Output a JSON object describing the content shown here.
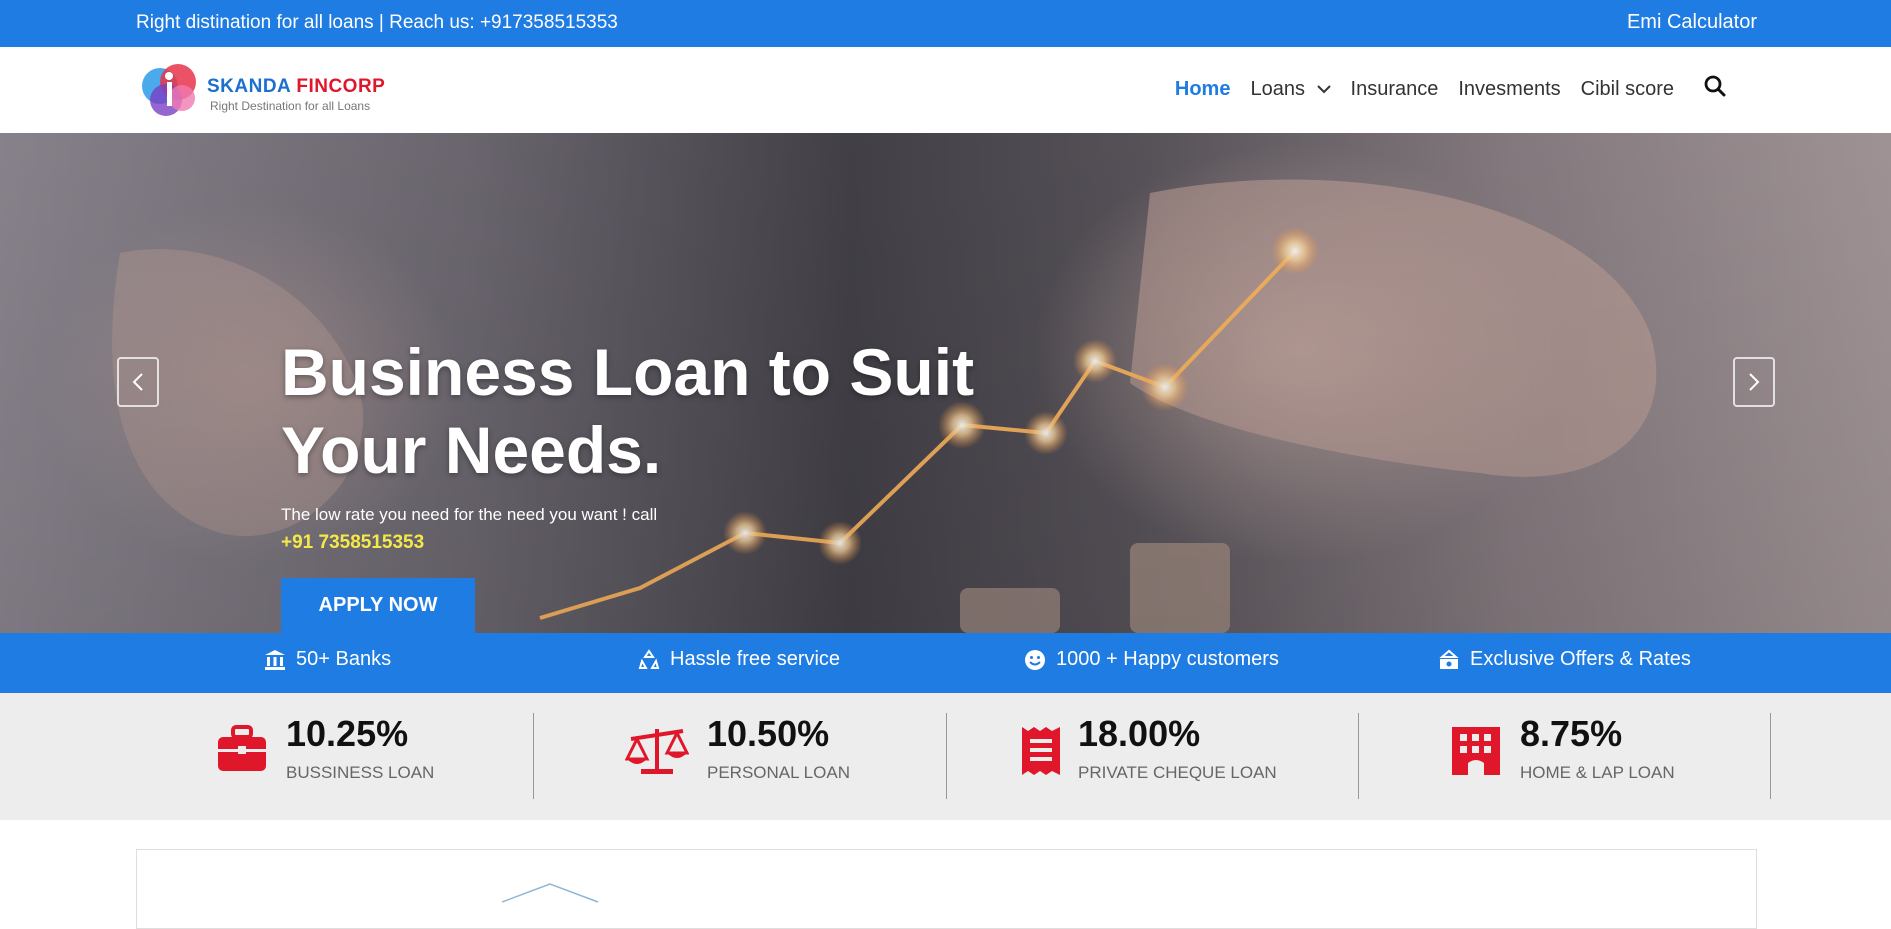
{
  "topbar": {
    "tagline": "Right distination for all loans | Reach us: +917358515353",
    "emi_link": "Emi Calculator"
  },
  "logo": {
    "brand_part1": "SKANDA",
    "brand_part2": "FINCORP",
    "subtitle": "Right Destination for all Loans"
  },
  "nav": {
    "items": [
      {
        "label": "Home",
        "active": true
      },
      {
        "label": "Loans",
        "has_dropdown": true
      },
      {
        "label": "Insurance"
      },
      {
        "label": "Invesments"
      },
      {
        "label": "Cibil score"
      }
    ],
    "search_icon": "search-icon"
  },
  "hero": {
    "heading": "Business Loan to Suit Your Needs.",
    "lead": "The low rate you need for the need you want ! call",
    "phone": "+91 7358515353",
    "cta": "APPLY NOW"
  },
  "features": [
    {
      "icon": "bank-icon",
      "label": "50+ Banks"
    },
    {
      "icon": "recycle-icon",
      "label": "Hassle free service"
    },
    {
      "icon": "smile-icon",
      "label": "1000 + Happy customers"
    },
    {
      "icon": "offers-icon",
      "label": "Exclusive Offers & Rates"
    }
  ],
  "rates": [
    {
      "icon": "briefcase-icon",
      "value": "10.25%",
      "label": "BUSSINESS LOAN"
    },
    {
      "icon": "scales-icon",
      "value": "10.50%",
      "label": "PERSONAL LOAN"
    },
    {
      "icon": "receipt-icon",
      "value": "18.00%",
      "label": "PRIVATE CHEQUE LOAN"
    },
    {
      "icon": "building-icon",
      "value": "8.75%",
      "label": "HOME & LAP LOAN"
    }
  ],
  "colors": {
    "primary": "#1e7ce2",
    "accent_red": "#e0162b",
    "phone_yellow": "#f5e94a"
  }
}
